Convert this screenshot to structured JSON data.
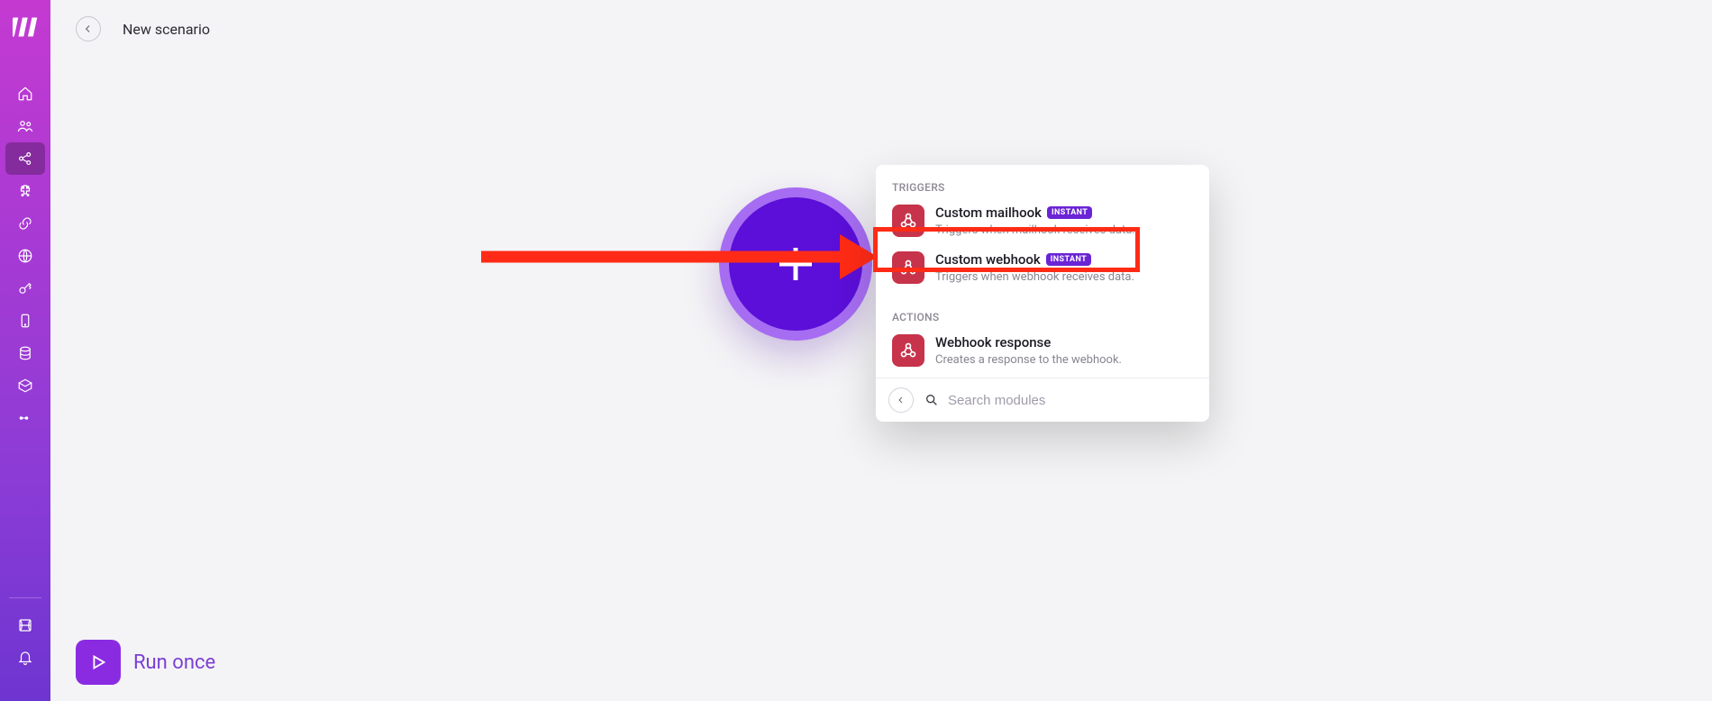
{
  "topbar": {
    "title": "New scenario"
  },
  "panel": {
    "triggers_header": "TRIGGERS",
    "actions_header": "ACTIONS",
    "search_placeholder": "Search modules",
    "triggers": [
      {
        "title": "Custom mailhook",
        "badge": "INSTANT",
        "desc": "Triggers when mailhook receives data."
      },
      {
        "title": "Custom webhook",
        "badge": "INSTANT",
        "desc": "Triggers when webhook receives data."
      }
    ],
    "actions": [
      {
        "title": "Webhook response",
        "desc": "Creates a response to the webhook."
      }
    ]
  },
  "run": {
    "label": "Run once"
  }
}
